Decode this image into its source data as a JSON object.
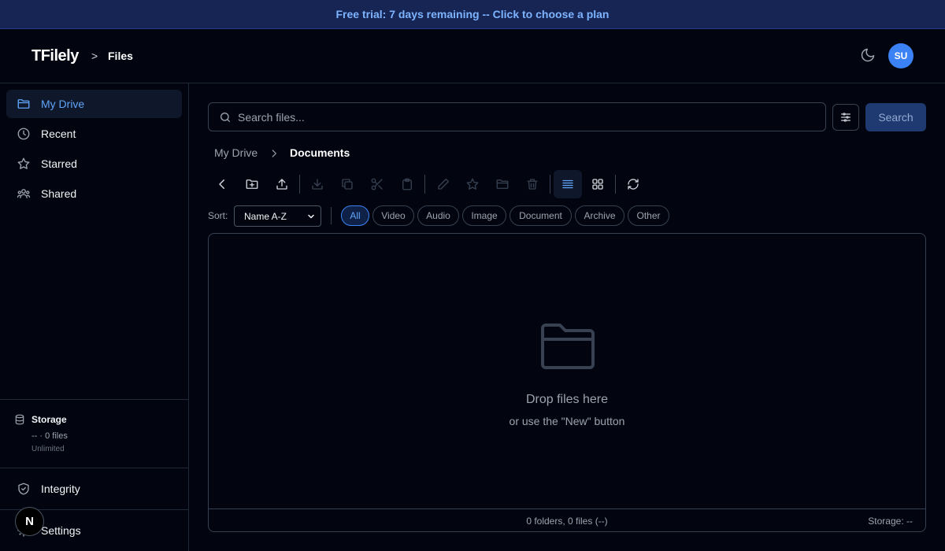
{
  "banner": {
    "text": "Free trial: 7 days remaining -- Click to choose a plan"
  },
  "header": {
    "logo": "TFilely",
    "breadcrumb_sep": ">",
    "section": "Files",
    "avatar_initials": "SU",
    "theme_icon": "moon-icon"
  },
  "sidebar": {
    "items": [
      {
        "label": "My Drive",
        "icon": "folder-icon",
        "active": true
      },
      {
        "label": "Recent",
        "icon": "clock-icon"
      },
      {
        "label": "Starred",
        "icon": "star-icon"
      },
      {
        "label": "Shared",
        "icon": "users-icon"
      }
    ],
    "storage": {
      "title": "Storage",
      "summary": "-- · 0 files",
      "limit": "Unlimited"
    },
    "integrity": "Integrity",
    "settings": "Settings",
    "dev_badge": "N"
  },
  "search": {
    "placeholder": "Search files...",
    "value": "",
    "button": "Search"
  },
  "path": {
    "root": "My Drive",
    "current": "Documents"
  },
  "toolbar": {
    "buttons": [
      "back",
      "new-folder",
      "upload",
      "download",
      "copy",
      "cut",
      "paste",
      "rename",
      "star",
      "move",
      "delete",
      "list-view",
      "grid-view",
      "refresh"
    ],
    "active_view": "list-view"
  },
  "filters": {
    "sort_label": "Sort:",
    "sort_value": "Name A-Z",
    "types": [
      "All",
      "Video",
      "Audio",
      "Image",
      "Document",
      "Archive",
      "Other"
    ],
    "active_type": "All"
  },
  "dropzone": {
    "title": "Drop files here",
    "subtitle": "or use the \"New\" button",
    "counts": "0 folders, 0 files (--)",
    "storage": "Storage: --"
  },
  "colors": {
    "accent": "#3b82f6",
    "background": "#020510",
    "banner_bg": "#172554",
    "banner_text": "#7db4ff"
  }
}
